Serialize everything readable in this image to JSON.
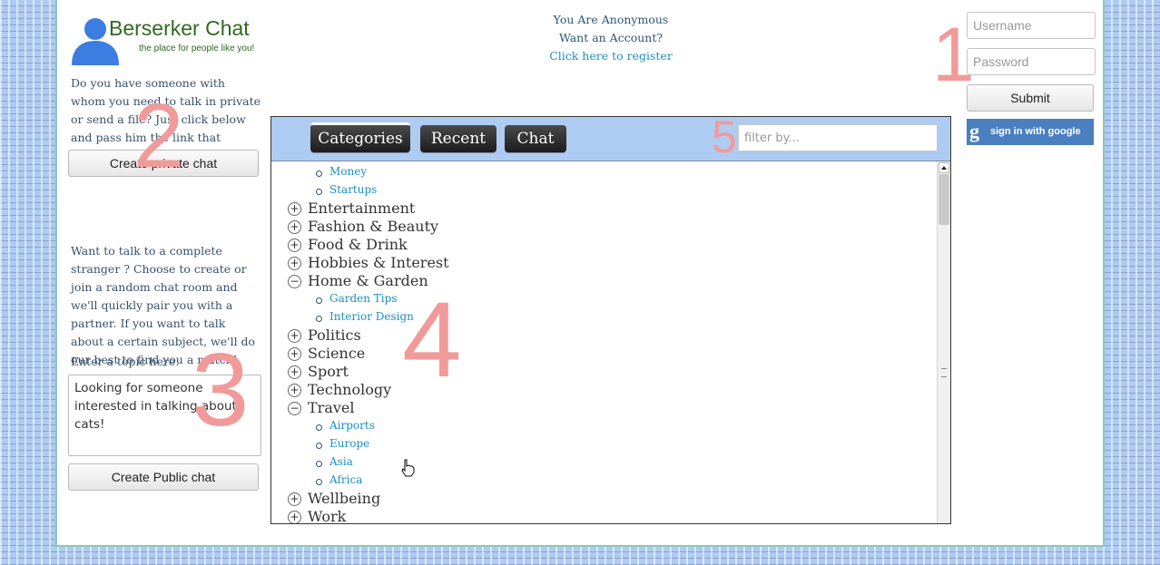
{
  "brand": {
    "title": "Berserker Chat",
    "tagline": "the place for people like you!"
  },
  "private_section": {
    "intro": "Do you have someone with whom you need to talk in private or send a file? Just click below and pass him the link that appears in the browser!",
    "button_label": "Create private chat"
  },
  "public_section": {
    "intro": "Want to talk to a complete stranger ? Choose to create or join a random chat room and we'll quickly pair you with a partner. If you want to talk about a certain subject, we'll do our best to find you a match!",
    "topic_label": "Enter a topic here:",
    "topic_value": "Looking for someone interested in talking about cats!",
    "button_label": "Create Public chat"
  },
  "account_status": {
    "line1": "You Are Anonymous",
    "line2": "Want an Account?",
    "register_link": "Click here to register"
  },
  "login": {
    "username_placeholder": "Username",
    "password_placeholder": "Password",
    "submit_label": "Submit",
    "google_label": "sign in with google",
    "google_glyph": "g"
  },
  "annotations": [
    "1",
    "2",
    "3",
    "4",
    "5"
  ],
  "tabs": [
    {
      "label": "Categories",
      "active": true
    },
    {
      "label": "Recent",
      "active": false
    },
    {
      "label": "Chat",
      "active": false
    }
  ],
  "filter": {
    "placeholder": "filter by..."
  },
  "tree": {
    "top_subitems": [
      "Money",
      "Startups"
    ],
    "categories": [
      {
        "label": "Entertainment",
        "expanded": false,
        "toggle": "+",
        "items": []
      },
      {
        "label": "Fashion & Beauty",
        "expanded": false,
        "toggle": "+",
        "items": []
      },
      {
        "label": "Food & Drink",
        "expanded": false,
        "toggle": "+",
        "items": []
      },
      {
        "label": "Hobbies & Interest",
        "expanded": false,
        "toggle": "+",
        "items": []
      },
      {
        "label": "Home & Garden",
        "expanded": true,
        "toggle": "−",
        "items": [
          "Garden Tips",
          "Interior Design"
        ]
      },
      {
        "label": "Politics",
        "expanded": false,
        "toggle": "+",
        "items": []
      },
      {
        "label": "Science",
        "expanded": false,
        "toggle": "+",
        "items": []
      },
      {
        "label": "Sport",
        "expanded": false,
        "toggle": "+",
        "items": []
      },
      {
        "label": "Technology",
        "expanded": false,
        "toggle": "+",
        "items": []
      },
      {
        "label": "Travel",
        "expanded": true,
        "toggle": "−",
        "items": [
          "Airports",
          "Europe",
          "Asia",
          "Africa"
        ]
      },
      {
        "label": "Wellbeing",
        "expanded": false,
        "toggle": "+",
        "items": []
      },
      {
        "label": "Work",
        "expanded": false,
        "toggle": "+",
        "items": []
      }
    ]
  },
  "colors": {
    "brand_green": "#2f6a1f",
    "link_blue": "#1a8fc4",
    "panel_header": "#aecbf2",
    "annotation_pink": "#f19a9a",
    "google_blue": "#4a7fc0"
  }
}
